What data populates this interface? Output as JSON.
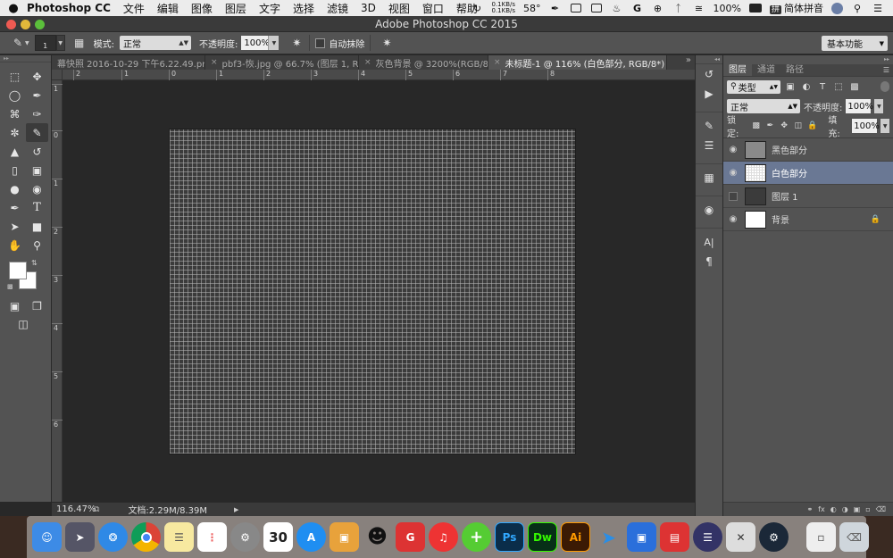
{
  "menubar": {
    "apple": "",
    "app_name": "Photoshop CC",
    "items": [
      "文件",
      "编辑",
      "图像",
      "图层",
      "文字",
      "选择",
      "滤镜",
      "3D",
      "视图",
      "窗口",
      "帮助"
    ],
    "net_up": "0.1KB/s",
    "net_down": "0.1KB/s",
    "temperature": "58°",
    "battery": "100%",
    "ime": "简体拼音",
    "ime_badge": "拼"
  },
  "window": {
    "title": "Adobe Photoshop CC 2015"
  },
  "options": {
    "brush_size": "1",
    "mode_label": "模式:",
    "mode_value": "正常",
    "opacity_label": "不透明度:",
    "opacity_value": "100%",
    "auto_erase_label": "自动抹除",
    "workspace": "基本功能"
  },
  "tabs": [
    {
      "label": "幕快照 2016-10-29 下午6.22.49.png"
    },
    {
      "label": "pbf3-恢.jpg @ 66.7% (图层 1, R..."
    },
    {
      "label": "灰色背景 @ 3200%(RGB/8..."
    },
    {
      "label": "未标题-1 @ 116% (白色部分, RGB/8*) *"
    }
  ],
  "tab_overflow": "»",
  "ruler_h": [
    "2",
    "1",
    "0",
    "1",
    "2",
    "3",
    "4",
    "5",
    "6",
    "7",
    "8"
  ],
  "ruler_v": [
    "1",
    "0",
    "1",
    "2",
    "3",
    "4",
    "5",
    "6"
  ],
  "status": {
    "zoom": "116.47%",
    "doc_info": "文档:2.29M/8.39M"
  },
  "layers_panel": {
    "tabs": [
      "图层",
      "通道",
      "路径"
    ],
    "filter_kind": "类型",
    "blend_mode": "正常",
    "opacity_label": "不透明度:",
    "opacity_value": "100%",
    "lock_label": "锁定:",
    "fill_label": "填充:",
    "fill_value": "100%",
    "layers": [
      {
        "name": "黑色部分",
        "visible": true,
        "selected": false,
        "thumb": "gray"
      },
      {
        "name": "白色部分",
        "visible": true,
        "selected": true,
        "thumb": "white-checker"
      },
      {
        "name": "图层 1",
        "visible": false,
        "selected": false,
        "thumb": "dark"
      },
      {
        "name": "背景",
        "visible": true,
        "selected": false,
        "thumb": "white",
        "locked": true
      }
    ]
  },
  "dock": {
    "calendar_day": "30",
    "apps": [
      "Ps",
      "Dw",
      "Ai"
    ]
  },
  "colors": {
    "accent_selected_layer": "#6a7894",
    "ps_blue": "#0a2d4a",
    "dw_green": "#072f17",
    "ai_orange": "#3b1a04"
  }
}
